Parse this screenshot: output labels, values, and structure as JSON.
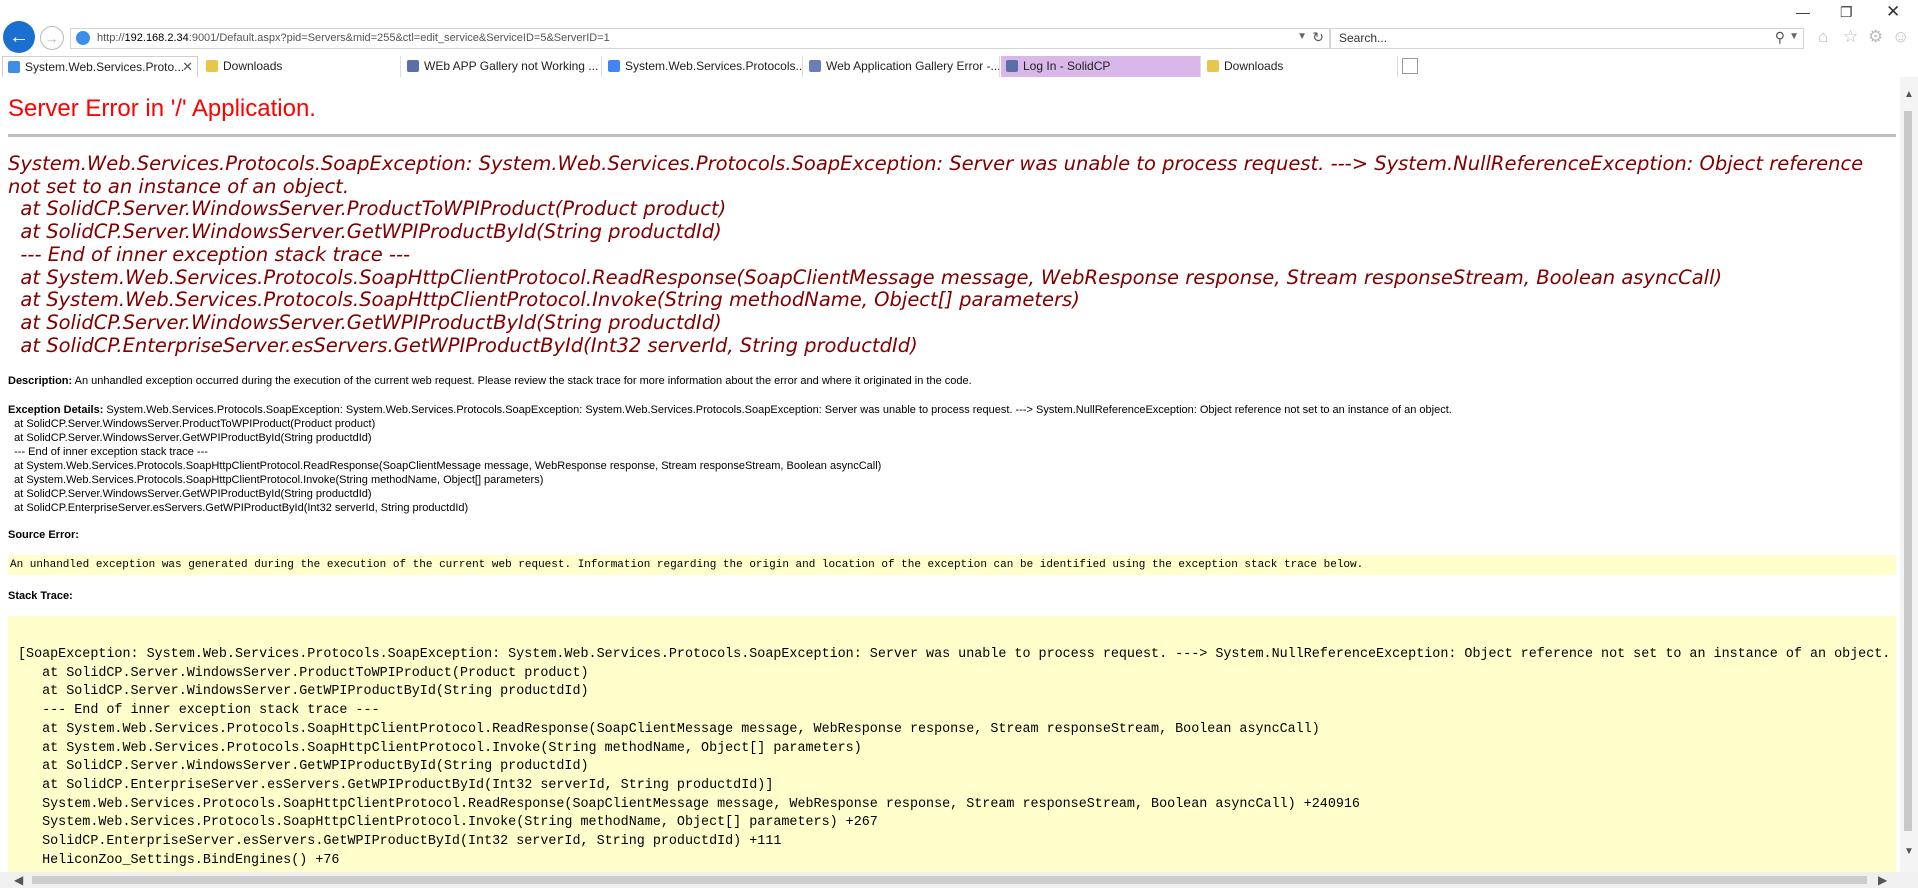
{
  "browser": {
    "url_prefix": "http://",
    "url_host": "192.168.2.34",
    "url_rest": ":9001/Default.aspx?pid=Servers&mid=255&ctl=edit_service&ServiceID=5&ServerID=1",
    "search_placeholder": "Search...",
    "tabs": [
      {
        "label": "System.Web.Services.Proto...",
        "active": true
      },
      {
        "label": "Downloads"
      },
      {
        "label": "WEb APP Gallery not Working ..."
      },
      {
        "label": "System.Web.Services.Protocols..."
      },
      {
        "label": "Web Application Gallery Error -..."
      },
      {
        "label": "Log In - SolidCP"
      },
      {
        "label": "Downloads"
      }
    ],
    "colors": {
      "back_button": "#1a6fcf",
      "purple_tab": "#d9b7e8"
    }
  },
  "page": {
    "title": "Server Error in '/' Application.",
    "error_lines": [
      "System.Web.Services.Protocols.SoapException: System.Web.Services.Protocols.SoapException: Server was unable to process request. ---> System.NullReferenceException: Object reference not set to an instance of an object.",
      "  at SolidCP.Server.WindowsServer.ProductToWPIProduct(Product product)",
      "  at SolidCP.Server.WindowsServer.GetWPIProductById(String productdId)",
      "  --- End of inner exception stack trace ---",
      "  at System.Web.Services.Protocols.SoapHttpClientProtocol.ReadResponse(SoapClientMessage message, WebResponse response, Stream responseStream, Boolean asyncCall)",
      "  at System.Web.Services.Protocols.SoapHttpClientProtocol.Invoke(String methodName, Object[] parameters)",
      "  at SolidCP.Server.WindowsServer.GetWPIProductById(String productdId)",
      "  at SolidCP.EnterpriseServer.esServers.GetWPIProductById(Int32 serverId, String productdId)"
    ],
    "description_label": "Description:",
    "description_text": " An unhandled exception occurred during the execution of the current web request. Please review the stack trace for more information about the error and where it originated in the code.",
    "exception_label": "Exception Details:",
    "exception_lines": [
      " System.Web.Services.Protocols.SoapException: System.Web.Services.Protocols.SoapException: System.Web.Services.Protocols.SoapException: Server was unable to process request. ---> System.NullReferenceException: Object reference not set to an instance of an object.",
      "  at SolidCP.Server.WindowsServer.ProductToWPIProduct(Product product)",
      "  at SolidCP.Server.WindowsServer.GetWPIProductById(String productdId)",
      "  --- End of inner exception stack trace ---",
      "  at System.Web.Services.Protocols.SoapHttpClientProtocol.ReadResponse(SoapClientMessage message, WebResponse response, Stream responseStream, Boolean asyncCall)",
      "  at System.Web.Services.Protocols.SoapHttpClientProtocol.Invoke(String methodName, Object[] parameters)",
      "  at SolidCP.Server.WindowsServer.GetWPIProductById(String productdId)",
      "  at SolidCP.EnterpriseServer.esServers.GetWPIProductById(Int32 serverId, String productdId)"
    ],
    "source_error_label": "Source Error:",
    "source_error_text": "An unhandled exception was generated during the execution of the current web request. Information regarding the origin and location of the exception can be identified using the exception stack trace below.",
    "stack_trace_label": "Stack Trace:",
    "stack_lines": [
      "[SoapException: System.Web.Services.Protocols.SoapException: System.Web.Services.Protocols.SoapException: Server was unable to process request. ---> System.NullReferenceException: Object reference not set to an instance of an object.",
      "   at SolidCP.Server.WindowsServer.ProductToWPIProduct(Product product)",
      "   at SolidCP.Server.WindowsServer.GetWPIProductById(String productdId)",
      "   --- End of inner exception stack trace ---",
      "   at System.Web.Services.Protocols.SoapHttpClientProtocol.ReadResponse(SoapClientMessage message, WebResponse response, Stream responseStream, Boolean asyncCall)",
      "   at System.Web.Services.Protocols.SoapHttpClientProtocol.Invoke(String methodName, Object[] parameters)",
      "   at SolidCP.Server.WindowsServer.GetWPIProductById(String productdId)",
      "   at SolidCP.EnterpriseServer.esServers.GetWPIProductById(Int32 serverId, String productdId)]",
      "   System.Web.Services.Protocols.SoapHttpClientProtocol.ReadResponse(SoapClientMessage message, WebResponse response, Stream responseStream, Boolean asyncCall) +240916",
      "   System.Web.Services.Protocols.SoapHttpClientProtocol.Invoke(String methodName, Object[] parameters) +267",
      "   SolidCP.EnterpriseServer.esServers.GetWPIProductById(Int32 serverId, String productdId) +111",
      "   HeliconZoo_Settings.BindEngines() +76"
    ],
    "colors": {
      "title": "#ff0000",
      "error": "#800000",
      "highlight_box": "#ffffcc"
    }
  }
}
